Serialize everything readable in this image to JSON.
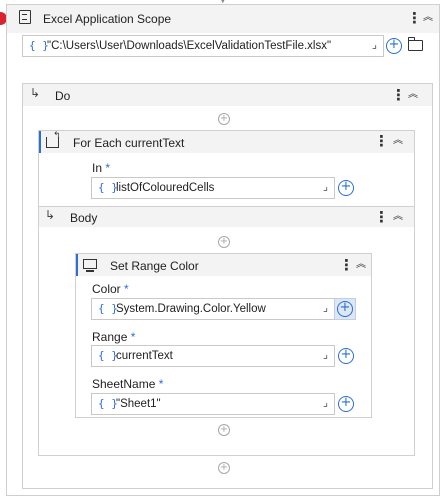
{
  "excel_scope": {
    "title": "Excel Application Scope",
    "path_value": "\"C:\\Users\\User\\Downloads\\ExcelValidationTestFile.xlsx\""
  },
  "do_section": {
    "label": "Do"
  },
  "for_each": {
    "title": "For Each currentText",
    "in_label": "In",
    "in_required": "*",
    "in_value": "listOfColouredCells"
  },
  "body_section": {
    "label": "Body"
  },
  "set_range_color": {
    "title": "Set Range Color",
    "color_label": "Color",
    "color_required": "*",
    "color_value": "System.Drawing.Color.Yellow",
    "range_label": "Range",
    "range_required": "*",
    "range_value": "currentText",
    "sheet_label": "SheetName",
    "sheet_required": "*",
    "sheet_value": "\"Sheet1\""
  },
  "icons": {
    "kebab": "⋮",
    "collapse": "︽",
    "brace": "{ }",
    "expand": "⌟",
    "plus": "+",
    "branch": "↳"
  },
  "colors": {
    "accent": "#2a6fd6",
    "breakpoint": "#d9232e",
    "header_bg": "#f3f3f3",
    "border": "#c9c9c9"
  }
}
